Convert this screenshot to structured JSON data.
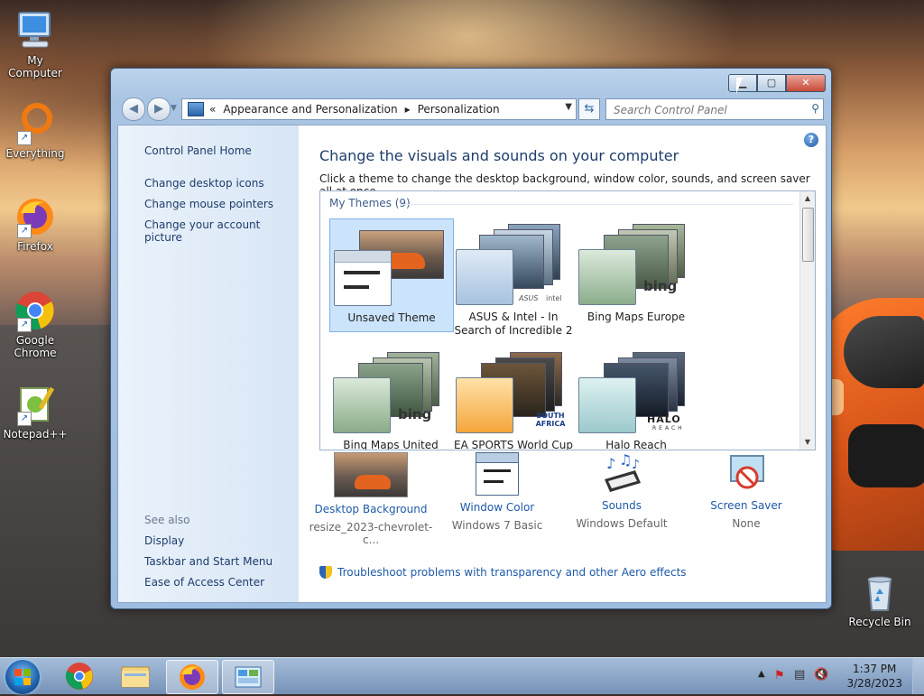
{
  "desktop": {
    "icons": [
      {
        "label": "My Computer"
      },
      {
        "label": "Everything"
      },
      {
        "label": "Firefox"
      },
      {
        "label": "Google Chrome"
      },
      {
        "label": "Notepad++"
      },
      {
        "label": "Recycle Bin"
      }
    ]
  },
  "window": {
    "address": {
      "overflow": "«",
      "crumbs": [
        "Appearance and Personalization",
        "Personalization"
      ]
    },
    "search_placeholder": "Search Control Panel",
    "left_pane": {
      "links": [
        "Control Panel Home",
        "Change desktop icons",
        "Change mouse pointers",
        "Change your account picture"
      ],
      "see_also_label": "See also",
      "see_also": [
        "Display",
        "Taskbar and Start Menu",
        "Ease of Access Center"
      ]
    },
    "main": {
      "title": "Change the visuals and sounds on your computer",
      "subtitle": "Click a theme to change the desktop background, window color, sounds, and screen saver all at once.",
      "group_label": "My Themes (9)",
      "themes": [
        {
          "name": "Unsaved Theme",
          "selected": true
        },
        {
          "name": "ASUS & Intel - In Search of Incredible 2"
        },
        {
          "name": "Bing Maps Europe"
        },
        {
          "name": "Bing Maps United"
        },
        {
          "name": "EA SPORTS World Cup"
        },
        {
          "name": "Halo Reach"
        }
      ],
      "logos": {
        "bing": "bing",
        "asus": "ASUS",
        "intel": "intel",
        "south_africa": "SOUTH AFRICA",
        "halo": "HALO",
        "reach": "REACH"
      },
      "bottom": [
        {
          "label": "Desktop Background",
          "value": "resize_2023-chevrolet-c..."
        },
        {
          "label": "Window Color",
          "value": "Windows 7 Basic"
        },
        {
          "label": "Sounds",
          "value": "Windows Default"
        },
        {
          "label": "Screen Saver",
          "value": "None"
        }
      ],
      "troubleshoot": "Troubleshoot problems with transparency and other Aero effects"
    }
  },
  "taskbar": {
    "time": "1:37 PM",
    "date": "3/28/2023"
  },
  "colors": {
    "accent": "#1e5aa8",
    "title_text": "#1e3d6b"
  }
}
